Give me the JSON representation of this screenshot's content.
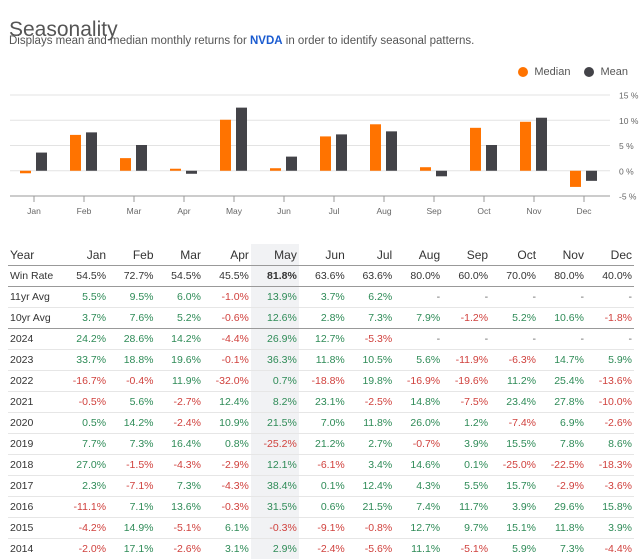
{
  "header": {
    "title": "Seasonality",
    "subtitle_prefix": "Displays mean and median monthly returns for ",
    "ticker": "NVDA",
    "subtitle_suffix": " in order to identify seasonal patterns."
  },
  "colors": {
    "median": "#ff7300",
    "mean": "#434348",
    "positive": "#2e8b57",
    "negative": "#d0413d",
    "ticker": "#1a5bd0"
  },
  "chart_data": {
    "type": "bar",
    "title": "",
    "xlabel": "",
    "ylabel": "",
    "categories": [
      "Jan",
      "Feb",
      "Mar",
      "Apr",
      "May",
      "Jun",
      "Jul",
      "Aug",
      "Sep",
      "Oct",
      "Nov",
      "Dec"
    ],
    "series": [
      {
        "name": "Median",
        "color": "#ff7300",
        "values": [
          -0.5,
          7.1,
          2.5,
          0.4,
          10.1,
          0.5,
          6.8,
          9.2,
          0.7,
          8.5,
          9.7,
          -3.2
        ]
      },
      {
        "name": "Mean",
        "color": "#434348",
        "values": [
          3.6,
          7.6,
          5.1,
          -0.6,
          12.5,
          2.8,
          7.2,
          7.8,
          -1.1,
          5.1,
          10.5,
          -2.0
        ]
      }
    ],
    "ylim": [
      -5,
      15
    ],
    "yticks": [
      15,
      10,
      5,
      0,
      -5
    ],
    "ytick_labels": [
      "15 %",
      "10 %",
      "5 %",
      "0 %",
      "-5 %"
    ],
    "grid": true,
    "legend": "top-right",
    "y_axis_side": "right"
  },
  "table": {
    "year_header": "Year",
    "months": [
      "Jan",
      "Feb",
      "Mar",
      "Apr",
      "May",
      "Jun",
      "Jul",
      "Aug",
      "Sep",
      "Oct",
      "Nov",
      "Dec"
    ],
    "highlight_column": "May",
    "rows": [
      {
        "label": "Win Rate",
        "values": [
          "54.5%",
          "72.7%",
          "54.5%",
          "45.5%",
          "81.8%",
          "63.6%",
          "63.6%",
          "80.0%",
          "60.0%",
          "70.0%",
          "80.0%",
          "40.0%"
        ]
      },
      {
        "label": "11yr Avg",
        "values": [
          "5.5%",
          "9.5%",
          "6.0%",
          "-1.0%",
          "13.9%",
          "3.7%",
          "6.2%",
          "-",
          "-",
          "-",
          "-",
          "-"
        ]
      },
      {
        "label": "10yr Avg",
        "values": [
          "3.7%",
          "7.6%",
          "5.2%",
          "-0.6%",
          "12.6%",
          "2.8%",
          "7.3%",
          "7.9%",
          "-1.2%",
          "5.2%",
          "10.6%",
          "-1.8%"
        ]
      },
      {
        "label": "2024",
        "values": [
          "24.2%",
          "28.6%",
          "14.2%",
          "-4.4%",
          "26.9%",
          "12.7%",
          "-5.3%",
          "-",
          "-",
          "-",
          "-",
          "-"
        ]
      },
      {
        "label": "2023",
        "values": [
          "33.7%",
          "18.8%",
          "19.6%",
          "-0.1%",
          "36.3%",
          "11.8%",
          "10.5%",
          "5.6%",
          "-11.9%",
          "-6.3%",
          "14.7%",
          "5.9%"
        ]
      },
      {
        "label": "2022",
        "values": [
          "-16.7%",
          "-0.4%",
          "11.9%",
          "-32.0%",
          "0.7%",
          "-18.8%",
          "19.8%",
          "-16.9%",
          "-19.6%",
          "11.2%",
          "25.4%",
          "-13.6%"
        ]
      },
      {
        "label": "2021",
        "values": [
          "-0.5%",
          "5.6%",
          "-2.7%",
          "12.4%",
          "8.2%",
          "23.1%",
          "-2.5%",
          "14.8%",
          "-7.5%",
          "23.4%",
          "27.8%",
          "-10.0%"
        ]
      },
      {
        "label": "2020",
        "values": [
          "0.5%",
          "14.2%",
          "-2.4%",
          "10.9%",
          "21.5%",
          "7.0%",
          "11.8%",
          "26.0%",
          "1.2%",
          "-7.4%",
          "6.9%",
          "-2.6%"
        ]
      },
      {
        "label": "2019",
        "values": [
          "7.7%",
          "7.3%",
          "16.4%",
          "0.8%",
          "-25.2%",
          "21.2%",
          "2.7%",
          "-0.7%",
          "3.9%",
          "15.5%",
          "7.8%",
          "8.6%"
        ]
      },
      {
        "label": "2018",
        "values": [
          "27.0%",
          "-1.5%",
          "-4.3%",
          "-2.9%",
          "12.1%",
          "-6.1%",
          "3.4%",
          "14.6%",
          "0.1%",
          "-25.0%",
          "-22.5%",
          "-18.3%"
        ]
      },
      {
        "label": "2017",
        "values": [
          "2.3%",
          "-7.1%",
          "7.3%",
          "-4.3%",
          "38.4%",
          "0.1%",
          "12.4%",
          "4.3%",
          "5.5%",
          "15.7%",
          "-2.9%",
          "-3.6%"
        ]
      },
      {
        "label": "2016",
        "values": [
          "-11.1%",
          "7.1%",
          "13.6%",
          "-0.3%",
          "31.5%",
          "0.6%",
          "21.5%",
          "7.4%",
          "11.7%",
          "3.9%",
          "29.6%",
          "15.8%"
        ]
      },
      {
        "label": "2015",
        "values": [
          "-4.2%",
          "14.9%",
          "-5.1%",
          "6.1%",
          "-0.3%",
          "-9.1%",
          "-0.8%",
          "12.7%",
          "9.7%",
          "15.1%",
          "11.8%",
          "3.9%"
        ]
      },
      {
        "label": "2014",
        "values": [
          "-2.0%",
          "17.1%",
          "-2.6%",
          "3.1%",
          "2.9%",
          "-2.4%",
          "-5.6%",
          "11.1%",
          "-5.1%",
          "5.9%",
          "7.3%",
          "-4.4%"
        ]
      }
    ]
  }
}
